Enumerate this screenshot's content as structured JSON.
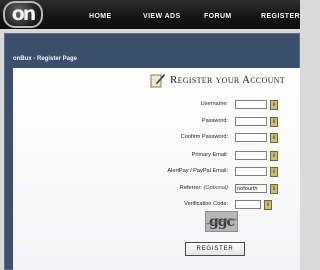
{
  "header": {
    "logo_text": "on",
    "nav": [
      "HOME",
      "VIEW ADS",
      "FORUM",
      "REGISTER"
    ]
  },
  "page": {
    "title": "onBux - Register Page",
    "heading": "Register your Account"
  },
  "form": {
    "fields": [
      {
        "label": "Username:",
        "value": ""
      },
      {
        "label": "Password:",
        "value": ""
      },
      {
        "label": "Confirm Password:",
        "value": ""
      },
      {
        "label": "Primary Email:",
        "value": ""
      },
      {
        "label": "AlertPay / PayPal Email:",
        "value": ""
      },
      {
        "label": "Referrer:",
        "note": "(Optional)",
        "value": "nofourth"
      },
      {
        "label": "Verification Code:",
        "value": ""
      }
    ],
    "help_glyph": "i",
    "captcha_text": "ggc",
    "submit_label": "REGISTER"
  },
  "colors": {
    "topbar": "#151515",
    "frame": "#3c4f6c",
    "panel": "#ffffff",
    "help_button": "#c9bf7a"
  },
  "icons": {
    "heading": "pen-icon",
    "help": "info-icon"
  }
}
